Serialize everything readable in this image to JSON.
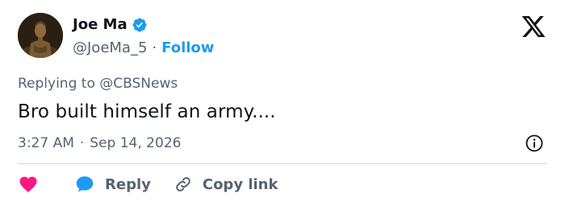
{
  "author": {
    "display_name": "Joe Ma",
    "handle": "@JoeMa_5",
    "follow_label": "Follow",
    "separator": "·"
  },
  "tweet": {
    "replying_prefix": "Replying to ",
    "replying_to": "@CBSNews",
    "text": "Bro built himself an army....",
    "time": "3:27 AM",
    "date_separator": "·",
    "date": "Sep 14, 2026"
  },
  "actions": {
    "reply_label": "Reply",
    "copy_link_label": "Copy link"
  },
  "icons": {
    "avatar": "avatar-statue",
    "verified": "verified-badge-icon",
    "logo": "x-logo-icon",
    "info": "info-icon",
    "like": "heart-icon",
    "reply": "speech-bubble-icon",
    "copy": "link-icon"
  },
  "colors": {
    "accent": "#1d9bf0",
    "like": "#f91880",
    "muted": "#536471",
    "text": "#0f1419",
    "divider": "#cfd9de"
  }
}
